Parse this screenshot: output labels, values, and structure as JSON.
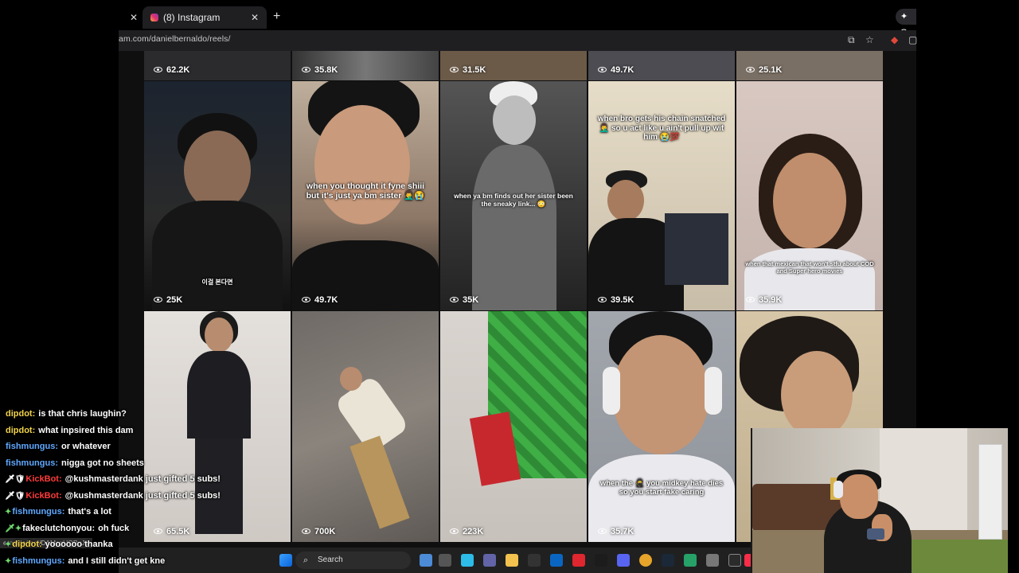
{
  "browser": {
    "tabs": [
      {
        "title": "(8) Instagram",
        "active": true
      }
    ],
    "new_tab_label": "+",
    "close_glyph": "✕",
    "gemini_label": "✦ G",
    "url": "am.com/danielbernaldo/reels/",
    "status_url": "ernaldo/reel/DAMcgUQPgJ-/",
    "icons": [
      "cast-icon",
      "star-icon",
      "extension-icon",
      "menu-icon"
    ]
  },
  "reels": {
    "row0": [
      {
        "views": "62.2K"
      },
      {
        "views": "35.8K"
      },
      {
        "views": "31.5K"
      },
      {
        "views": "49.7K"
      },
      {
        "views": "25.1K"
      }
    ],
    "row1": [
      {
        "views": "25K",
        "caption": "이걸 본다면"
      },
      {
        "views": "49.7K",
        "caption": "when you thought it fyne shiii but it's just ya bm sister 🤦‍♂️😭"
      },
      {
        "views": "35K",
        "caption": "when ya bm finds out her sister been the sneaky link... 😳"
      },
      {
        "views": "39.5K",
        "caption": "when bro gets his chain snatched 🤦‍♂️ so u act like u ain't pull up wit him 😭💯"
      },
      {
        "views": "35.9K",
        "caption": "when that mexican that won't stfu about COD and Super hero movies"
      }
    ],
    "row2": [
      {
        "views": "65.5K",
        "caption": ""
      },
      {
        "views": "700K",
        "caption": ""
      },
      {
        "views": "223K",
        "caption": ""
      },
      {
        "views": "35.7K",
        "caption": "when the 🥷 you midkey hate dies so you start fake caring"
      },
      {
        "views": "",
        "caption": ""
      }
    ]
  },
  "taskbar": {
    "search_placeholder": "Search"
  },
  "chat": [
    {
      "user": "dipdot:",
      "text": "is that chris laughin?",
      "color": "#f2d34a",
      "badges": ""
    },
    {
      "user": "dipdot:",
      "text": "what inpsired this dam",
      "color": "#f2d34a",
      "badges": ""
    },
    {
      "user": "fishmungus:",
      "text": "or whatever",
      "color": "#5fa8ff",
      "badges": ""
    },
    {
      "user": "fishmungus:",
      "text": "nigga got no sheets",
      "color": "#5fa8ff",
      "badges": ""
    },
    {
      "user": "KickBot:",
      "text": "@kushmasterdank just gifted 5 subs!",
      "color": "#ff3b3b",
      "badges": "🗡🛡"
    },
    {
      "user": "KickBot:",
      "text": "@kushmasterdank just gifted 5 subs!",
      "color": "#ff3b3b",
      "badges": "🗡🛡"
    },
    {
      "user": "fishmungus:",
      "text": "that's a lot",
      "color": "#5fa8ff",
      "badges": "✦"
    },
    {
      "user": "fakeclutchonyou:",
      "text": "oh fuck",
      "color": "#ffffff",
      "badges": "🗡✦"
    },
    {
      "user": "dipdot:",
      "text": "yoooooo thanka",
      "color": "#f2d34a",
      "badges": "✦"
    },
    {
      "user": "fishmungus:",
      "text": "and I still didn't get kne",
      "color": "#5fa8ff",
      "badges": "✦"
    }
  ],
  "colors": {
    "chrome_bg": "#1f1f22",
    "grid_bg": "#0f0f10",
    "kickbot": "#ff3b3b",
    "dipdot": "#f2d34a",
    "fishmungus": "#5fa8ff"
  }
}
